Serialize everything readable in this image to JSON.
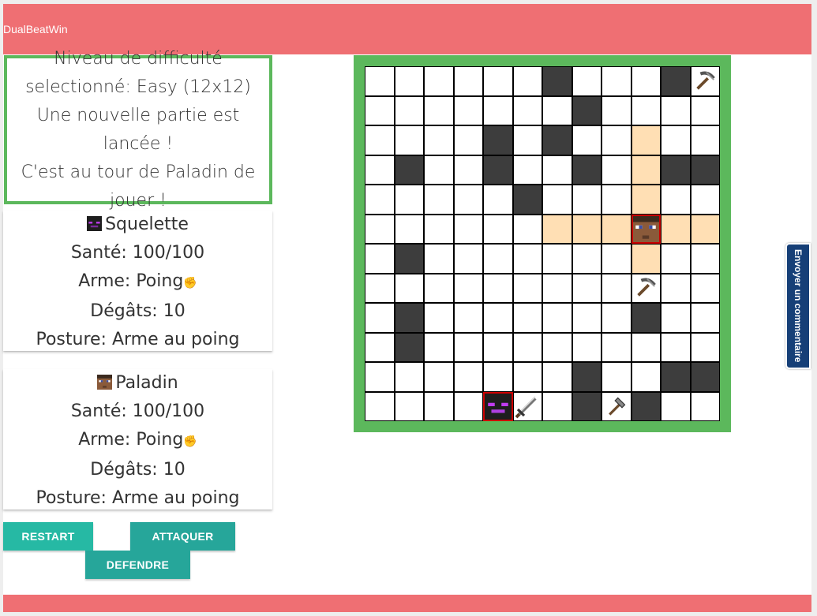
{
  "app": {
    "title": "DualBeatWin"
  },
  "status": {
    "lines": [
      "Niveau de difficulté",
      "selectionné: Easy (12x12)",
      "Une nouvelle partie est lancée !",
      "C'est au tour de Paladin de",
      "jouer !"
    ]
  },
  "players": [
    {
      "name": "Squelette",
      "health": "Santé: 100/100",
      "weapon": "Arme: Poing",
      "damage": "Dégâts: 10",
      "stance": "Posture: Arme au poing"
    },
    {
      "name": "Paladin",
      "health": "Santé: 100/100",
      "weapon": "Arme: Poing",
      "damage": "Dégâts: 10",
      "stance": "Posture: Arme au poing"
    }
  ],
  "buttons": {
    "restart": "RESTART",
    "attack": "ATTAQUER",
    "defend": "DEFENDRE"
  },
  "feedback": {
    "label": "Envoyer un commentaire"
  },
  "board": {
    "size": 12,
    "walls": [
      [
        0,
        6
      ],
      [
        0,
        10
      ],
      [
        1,
        7
      ],
      [
        2,
        4
      ],
      [
        2,
        6
      ],
      [
        3,
        1
      ],
      [
        3,
        4
      ],
      [
        3,
        7
      ],
      [
        3,
        10
      ],
      [
        3,
        11
      ],
      [
        4,
        5
      ],
      [
        6,
        1
      ],
      [
        8,
        1
      ],
      [
        8,
        9
      ],
      [
        9,
        1
      ],
      [
        10,
        7
      ],
      [
        10,
        10
      ],
      [
        10,
        11
      ],
      [
        11,
        7
      ],
      [
        11,
        9
      ]
    ],
    "highlight": [
      [
        2,
        9
      ],
      [
        3,
        9
      ],
      [
        4,
        9
      ],
      [
        5,
        6
      ],
      [
        5,
        7
      ],
      [
        5,
        8
      ],
      [
        5,
        10
      ],
      [
        5,
        11
      ],
      [
        6,
        9
      ]
    ],
    "items": [
      {
        "row": 0,
        "col": 11,
        "icon": "pickaxe-icon"
      },
      {
        "row": 7,
        "col": 9,
        "icon": "pickaxe-icon"
      },
      {
        "row": 11,
        "col": 5,
        "icon": "sword-icon"
      },
      {
        "row": 11,
        "col": 8,
        "icon": "axe-icon"
      }
    ],
    "players": [
      {
        "row": 5,
        "col": 9,
        "icon": "paladin-avatar-icon"
      },
      {
        "row": 11,
        "col": 4,
        "icon": "skeleton-avatar-icon"
      }
    ]
  },
  "colors": {
    "header": "#ef6f73",
    "board_border": "#5cb85c",
    "wall": "#3d3d3d",
    "move": "#ffdfb4",
    "button": "#26a69a"
  }
}
